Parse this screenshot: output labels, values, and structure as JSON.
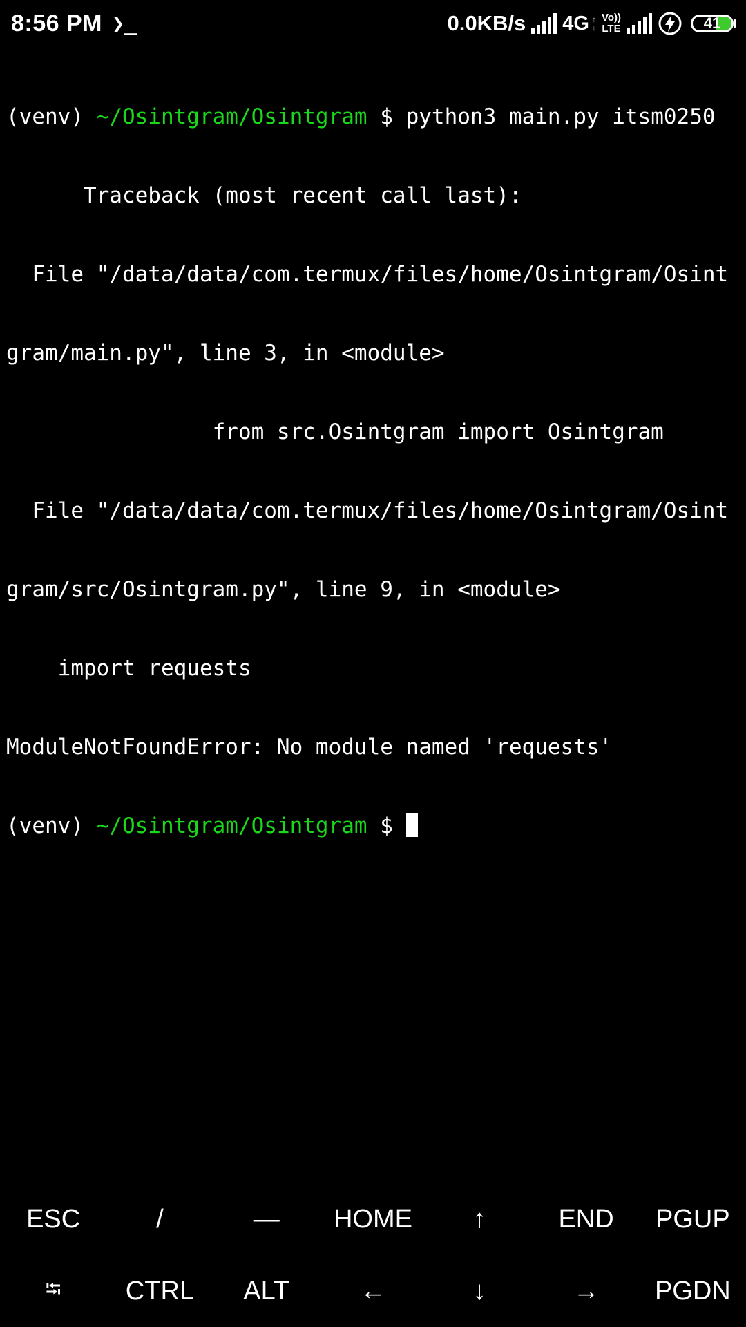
{
  "status_bar": {
    "time": "8:56 PM",
    "terminal_indicator": "❯_",
    "net_speed": "0.0KB/s",
    "network_type": "4G",
    "volte_top": "Vo))",
    "volte_bottom": "LTE",
    "battery_level": "41",
    "battery_percent": 41,
    "battery_color": "#3ecb2e",
    "icons": [
      "signal-icon",
      "signal-icon",
      "charging-bolt-icon",
      "battery-icon"
    ]
  },
  "terminal": {
    "prompt_prefix": "(venv) ",
    "prompt_path": "~/Osintgram/Osintgram",
    "prompt_symbol": " $ ",
    "command": "python3 main.py itsm0250",
    "path_color": "#1ad81a",
    "output": [
      "      Traceback (most recent call last):",
      "  File \"/data/data/com.termux/files/home/Osintgram/Osint",
      "gram/main.py\", line 3, in <module>",
      "                from src.Osintgram import Osintgram",
      "  File \"/data/data/com.termux/files/home/Osintgram/Osint",
      "gram/src/Osintgram.py\", line 9, in <module>",
      "    import requests",
      "ModuleNotFoundError: No module named 'requests'"
    ]
  },
  "extra_keys": {
    "row1": [
      "ESC",
      "/",
      "—",
      "HOME",
      "↑",
      "END",
      "PGUP"
    ],
    "row2": [
      "⭾",
      "CTRL",
      "ALT",
      "←",
      "↓",
      "→",
      "PGDN"
    ]
  }
}
